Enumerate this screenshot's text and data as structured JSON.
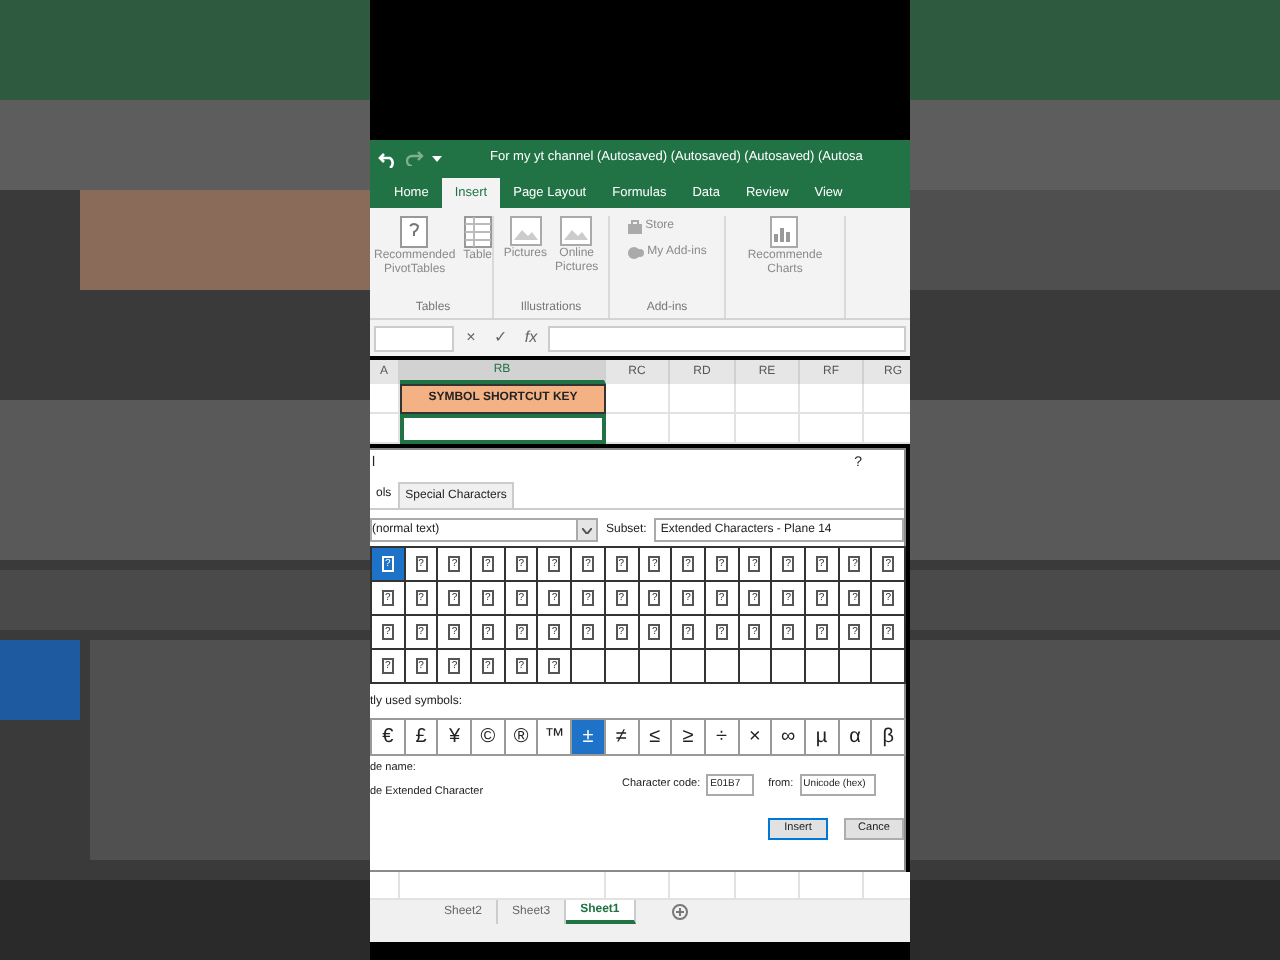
{
  "window": {
    "title": "For my yt channel (Autosaved) (Autosaved) (Autosaved) (Autosa"
  },
  "ribbon_tabs": [
    {
      "label": "Home",
      "selected": false
    },
    {
      "label": "Insert",
      "selected": true
    },
    {
      "label": "Page Layout",
      "selected": false
    },
    {
      "label": "Formulas",
      "selected": false
    },
    {
      "label": "Data",
      "selected": false
    },
    {
      "label": "Review",
      "selected": false
    },
    {
      "label": "View",
      "selected": false
    }
  ],
  "ribbon_groups": [
    {
      "label": "Tables",
      "items": [
        {
          "label": "Recommended\nPivotTables",
          "kind": "large"
        },
        {
          "label": "Table",
          "kind": "large"
        }
      ]
    },
    {
      "label": "Illustrations",
      "items": [
        {
          "label": "Pictures",
          "kind": "large"
        },
        {
          "label": "Online\nPictures",
          "kind": "large"
        }
      ]
    },
    {
      "label": "Add-ins",
      "items": [
        {
          "label": "Store",
          "kind": "small"
        },
        {
          "label": "My Add-ins",
          "kind": "small"
        }
      ]
    },
    {
      "items": [
        {
          "label": "Recommende\nCharts",
          "kind": "large"
        }
      ]
    }
  ],
  "formula_bar": {
    "buttons": [
      "×",
      "✓",
      "fx"
    ]
  },
  "columns": [
    {
      "label": "A",
      "selected": false
    },
    {
      "label": "RB",
      "selected": true
    },
    {
      "label": "RC",
      "selected": false
    },
    {
      "label": "RD",
      "selected": false
    },
    {
      "label": "RE",
      "selected": false
    },
    {
      "label": "RF",
      "selected": false
    },
    {
      "label": "RG",
      "selected": false
    }
  ],
  "banner_cell": {
    "text": "SYMBOL SHORTCUT KEY"
  },
  "dialog": {
    "title": "l",
    "help": "?",
    "tabs": [
      {
        "label": "ols",
        "selected": true
      },
      {
        "label": "Special Characters",
        "selected": false
      }
    ],
    "font": {
      "value": "(normal text)"
    },
    "subset": {
      "label": "Subset:",
      "value": "Extended Characters - Plane 14"
    },
    "symbols": [
      {
        "char": "?",
        "selected": true
      },
      {
        "char": "?",
        "selected": false
      },
      {
        "char": "?",
        "selected": false
      },
      {
        "char": "?",
        "selected": false
      },
      {
        "char": "?",
        "selected": false
      },
      {
        "char": "?",
        "selected": false
      },
      {
        "char": "?",
        "selected": false
      },
      {
        "char": "?",
        "selected": false
      },
      {
        "char": "?",
        "selected": false
      },
      {
        "char": "?",
        "selected": false
      },
      {
        "char": "?",
        "selected": false
      },
      {
        "char": "?",
        "selected": false
      },
      {
        "char": "?",
        "selected": false
      },
      {
        "char": "?",
        "selected": false
      },
      {
        "char": "?",
        "selected": false
      },
      {
        "char": "?",
        "selected": false
      },
      {
        "char": "?",
        "selected": false
      },
      {
        "char": "?",
        "selected": false
      },
      {
        "char": "?",
        "selected": false
      },
      {
        "char": "?",
        "selected": false
      },
      {
        "char": "?",
        "selected": false
      },
      {
        "char": "?",
        "selected": false
      },
      {
        "char": "?",
        "selected": false
      },
      {
        "char": "?",
        "selected": false
      },
      {
        "char": "?",
        "selected": false
      },
      {
        "char": "?",
        "selected": false
      },
      {
        "char": "?",
        "selected": false
      },
      {
        "char": "?",
        "selected": false
      },
      {
        "char": "?",
        "selected": false
      },
      {
        "char": "?",
        "selected": false
      },
      {
        "char": "?",
        "selected": false
      },
      {
        "char": "?",
        "selected": false
      },
      {
        "char": "?",
        "selected": false
      },
      {
        "char": "?",
        "selected": false
      },
      {
        "char": "?",
        "selected": false
      },
      {
        "char": "?",
        "selected": false
      },
      {
        "char": "?",
        "selected": false
      },
      {
        "char": "?",
        "selected": false
      },
      {
        "char": "?",
        "selected": false
      },
      {
        "char": "?",
        "selected": false
      },
      {
        "char": "?",
        "selected": false
      },
      {
        "char": "?",
        "selected": false
      },
      {
        "char": "?",
        "selected": false
      },
      {
        "char": "?",
        "selected": false
      },
      {
        "char": "?",
        "selected": false
      },
      {
        "char": "?",
        "selected": false
      },
      {
        "char": "?",
        "selected": false
      },
      {
        "char": "?",
        "selected": false
      },
      {
        "char": "?",
        "selected": false
      },
      {
        "char": "?",
        "selected": false
      },
      {
        "char": "?",
        "selected": false
      },
      {
        "char": "?",
        "selected": false
      },
      {
        "char": "?",
        "selected": false
      },
      {
        "char": "?",
        "selected": false
      }
    ],
    "recent_label": "tly used symbols:",
    "recent": [
      {
        "char": "€",
        "selected": false
      },
      {
        "char": "£",
        "selected": false
      },
      {
        "char": "¥",
        "selected": false
      },
      {
        "char": "©",
        "selected": false
      },
      {
        "char": "®",
        "selected": false
      },
      {
        "char": "™",
        "selected": false
      },
      {
        "char": "±",
        "selected": true
      },
      {
        "char": "≠",
        "selected": false
      },
      {
        "char": "≤",
        "selected": false
      },
      {
        "char": "≥",
        "selected": false
      },
      {
        "char": "÷",
        "selected": false
      },
      {
        "char": "×",
        "selected": false
      },
      {
        "char": "∞",
        "selected": false
      },
      {
        "char": "µ",
        "selected": false
      },
      {
        "char": "α",
        "selected": false
      },
      {
        "char": "β",
        "selected": false
      }
    ],
    "name_label": "de name:",
    "name_value": "de Extended Character",
    "code": {
      "label": "Character code:",
      "value": "E01B7"
    },
    "from": {
      "label": "from:",
      "value": "Unicode (hex)"
    },
    "buttons": [
      {
        "label": "Insert",
        "default": true
      },
      {
        "label": "Cance",
        "default": false
      }
    ]
  },
  "sheet_tabs": [
    {
      "label": "Sheet2",
      "selected": false
    },
    {
      "label": "Sheet3",
      "selected": false
    },
    {
      "label": "Sheet1",
      "selected": true
    }
  ]
}
